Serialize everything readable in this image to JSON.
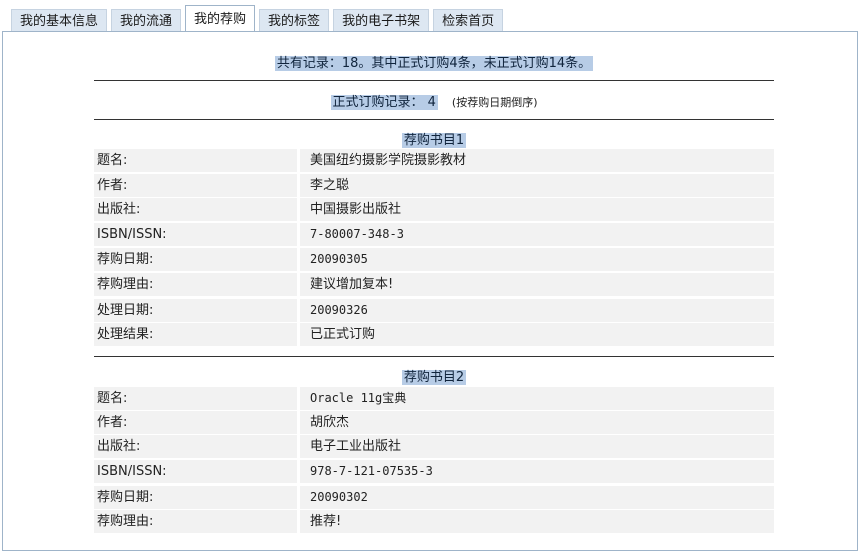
{
  "tabs": [
    "我的基本信息",
    "我的流通",
    "我的荐购",
    "我的标签",
    "我的电子书架",
    "检索首页"
  ],
  "summary": "共有记录：18。其中正式订购4条，未正式订购14条。",
  "formal": {
    "label": "正式订购记录： 4",
    "note": "(按荐购日期倒序)"
  },
  "records": [
    {
      "title": "荐购书目1",
      "fields": [
        {
          "k": "题名:",
          "v": "美国纽约摄影学院摄影教材"
        },
        {
          "k": "作者:",
          "v": "李之聪"
        },
        {
          "k": "出版社:",
          "v": "中国摄影出版社"
        },
        {
          "k": "ISBN/ISSN:",
          "v": "7-80007-348-3"
        },
        {
          "k": "荐购日期:",
          "v": "20090305"
        },
        {
          "k": "荐购理由:",
          "v": "建议增加复本!"
        },
        {
          "k": "处理日期:",
          "v": "20090326"
        },
        {
          "k": "处理结果:",
          "v": "已正式订购"
        }
      ]
    },
    {
      "title": "荐购书目2",
      "fields": [
        {
          "k": "题名:",
          "v": "Oracle 11g宝典"
        },
        {
          "k": "作者:",
          "v": "胡欣杰"
        },
        {
          "k": "出版社:",
          "v": "电子工业出版社"
        },
        {
          "k": "ISBN/ISSN:",
          "v": "978-7-121-07535-3"
        },
        {
          "k": "荐购日期:",
          "v": "20090302"
        },
        {
          "k": "荐购理由:",
          "v": "推荐!"
        }
      ]
    }
  ]
}
